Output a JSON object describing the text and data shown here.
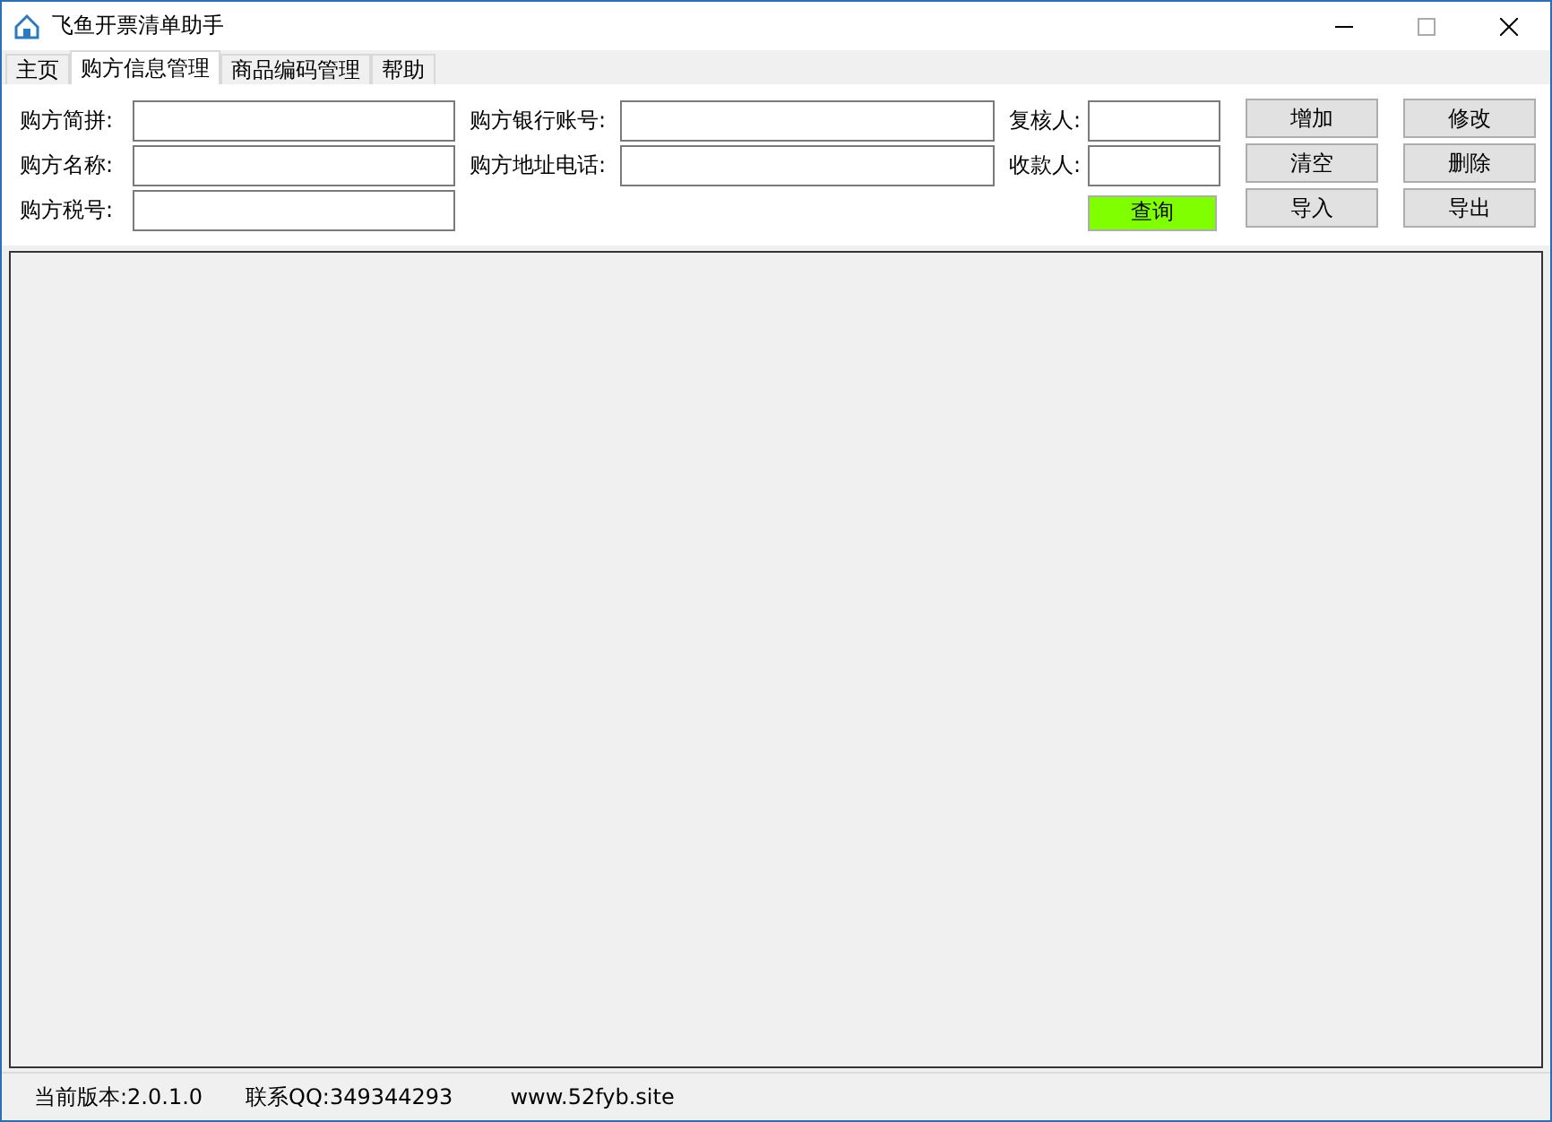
{
  "window": {
    "title": "飞鱼开票清单助手"
  },
  "tabs": [
    {
      "label": "主页",
      "selected": false
    },
    {
      "label": "购方信息管理",
      "selected": true
    },
    {
      "label": "商品编码管理",
      "selected": false
    },
    {
      "label": "帮助",
      "selected": false
    }
  ],
  "form": {
    "col1": [
      {
        "label": "购方简拼:"
      },
      {
        "label": "购方名称:"
      },
      {
        "label": "购方税号:"
      }
    ],
    "col2": [
      {
        "label": "购方银行账号:"
      },
      {
        "label": "购方地址电话:"
      }
    ],
    "col3": [
      {
        "label": "复核人:"
      },
      {
        "label": "收款人:"
      }
    ],
    "query_button": "查询",
    "buttons": [
      "增加",
      "修改",
      "清空",
      "删除",
      "导入",
      "导出"
    ]
  },
  "status_bar": {
    "version": "当前版本:2.0.1.0",
    "contact": "联系QQ:349344293",
    "website": "www.52fyb.site"
  }
}
